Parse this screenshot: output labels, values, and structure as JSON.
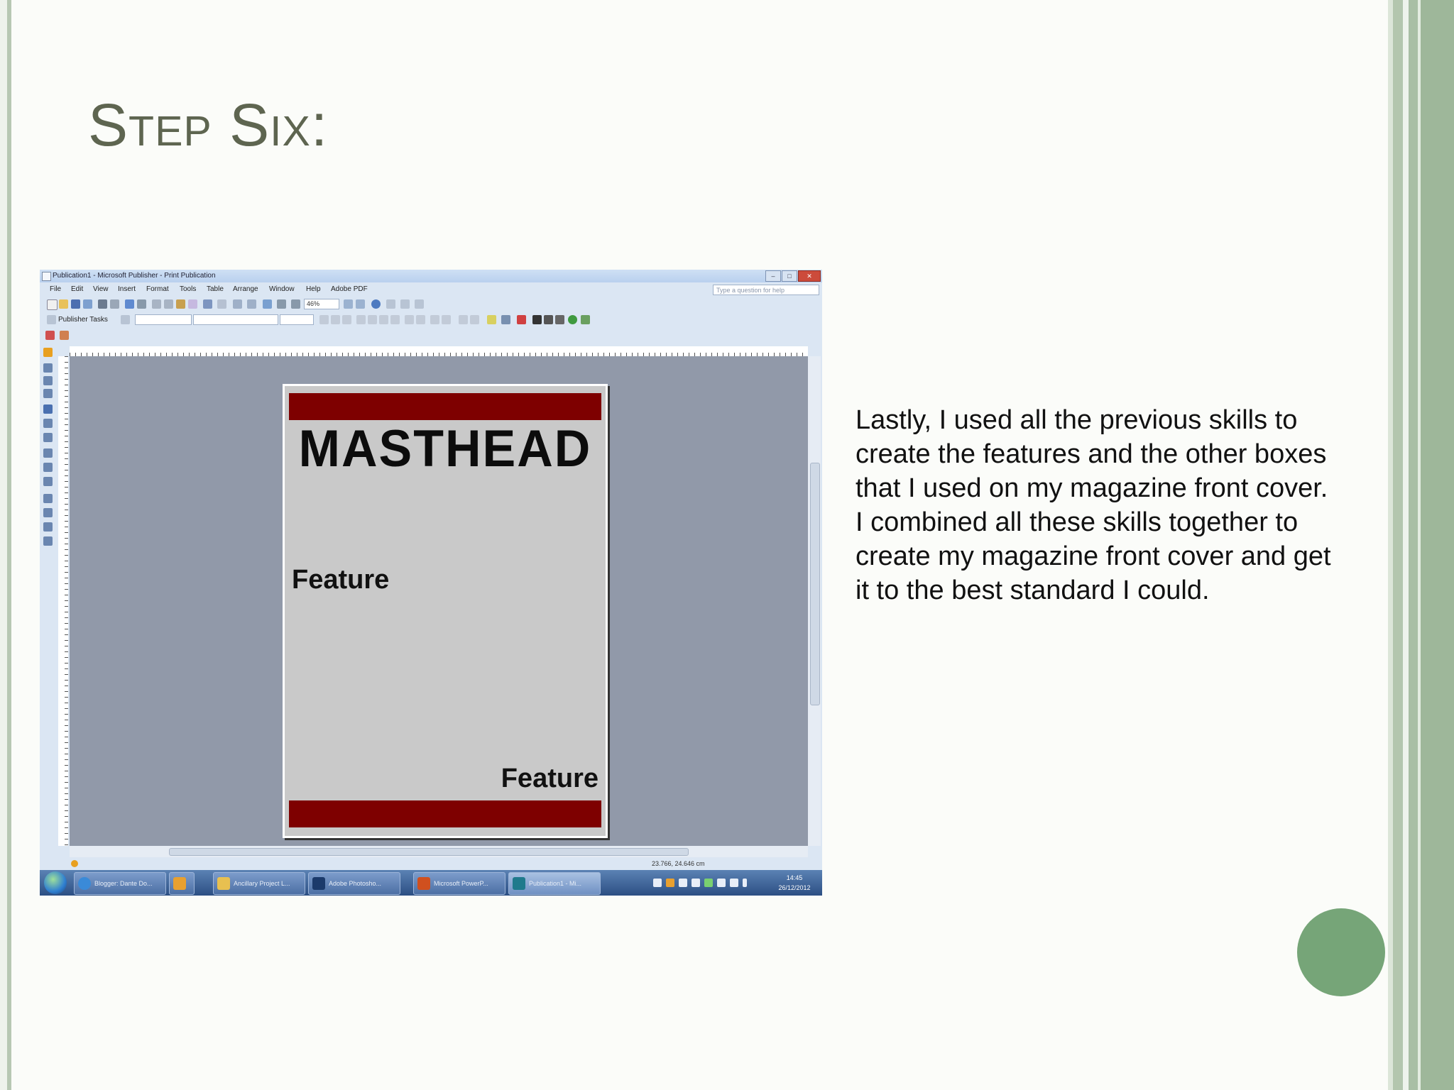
{
  "slide": {
    "title": "Step Six:",
    "body": "Lastly, I used all the previous skills to create the features and the other boxes that I used on my magazine front cover. I combined all these skills together to create my magazine front cover and get it to the best standard I could.",
    "accent_color": "#76a578",
    "title_color": "#5e6550"
  },
  "screenshot": {
    "window_title": "Publication1 - Microsoft Publisher - Print Publication",
    "menu": [
      "File",
      "Edit",
      "View",
      "Insert",
      "Format",
      "Tools",
      "Table",
      "Arrange",
      "Window",
      "Help",
      "Adobe PDF"
    ],
    "help_placeholder": "Type a question for help",
    "zoom": "46%",
    "publisher_tasks_label": "Publisher Tasks",
    "page": {
      "masthead": "MASTHEAD",
      "feature_1": "Feature",
      "feature_2": "Feature",
      "band_color": "#7e0000"
    },
    "status_position": "23.766, 24.646 cm",
    "taskbar": [
      {
        "label": "Blogger: Dante Do...",
        "icon": "internet-explorer-icon"
      },
      {
        "label": "",
        "icon": "media-player-icon"
      },
      {
        "label": "Ancillary Project L...",
        "icon": "folder-icon"
      },
      {
        "label": "Adobe Photosho...",
        "icon": "photoshop-icon"
      },
      {
        "label": "Microsoft PowerP...",
        "icon": "powerpoint-icon"
      },
      {
        "label": "Publication1 - Mi...",
        "icon": "publisher-icon"
      }
    ],
    "clock_time": "14:45",
    "clock_date": "26/12/2012"
  }
}
